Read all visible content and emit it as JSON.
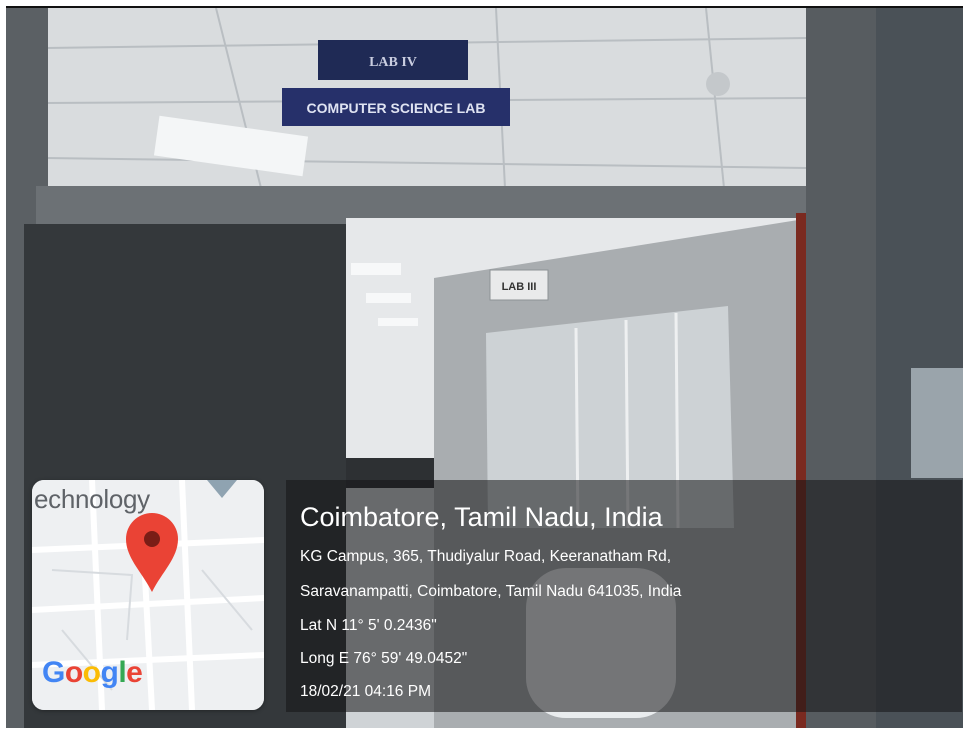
{
  "signs": {
    "lab_iv": "LAB IV",
    "cs_lab": "COMPUTER SCIENCE LAB",
    "lab_iii": "LAB III"
  },
  "map": {
    "area_label": "echnology",
    "logo": [
      "G",
      "o",
      "o",
      "g",
      "l",
      "e"
    ],
    "pin_color": "#EA4335"
  },
  "geotag": {
    "city": "Coimbatore, Tamil Nadu, India",
    "address_line1": "KG Campus, 365, Thudiyalur Road, Keeranatham Rd,",
    "address_line2": "Saravanampatti, Coimbatore, Tamil Nadu 641035, India",
    "latitude": "Lat N 11° 5' 0.2436\"",
    "longitude": "Long E 76° 59' 49.0452\"",
    "timestamp": "18/02/21 04:16 PM"
  }
}
